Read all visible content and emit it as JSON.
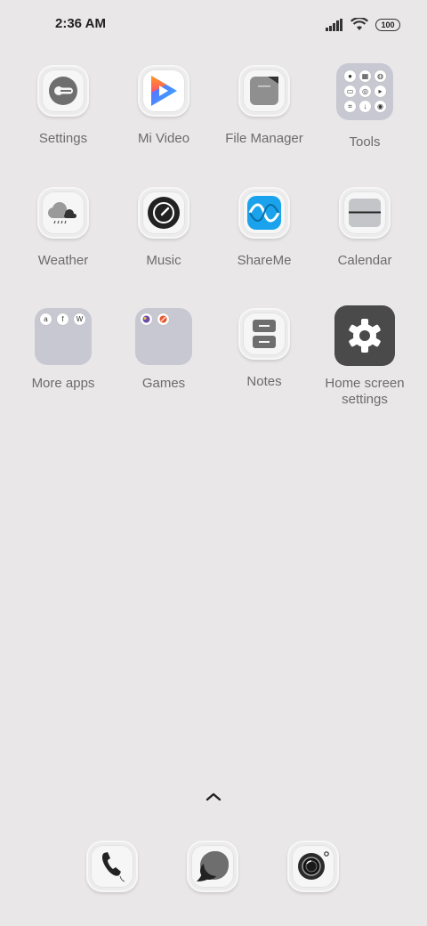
{
  "status_bar": {
    "time": "2:36 AM",
    "battery": "100"
  },
  "apps": {
    "settings": "Settings",
    "mi_video": "Mi Video",
    "file_manager": "File Manager",
    "tools": "Tools",
    "weather": "Weather",
    "music": "Music",
    "shareme": "ShareMe",
    "calendar": "Calendar",
    "more_apps": "More apps",
    "games": "Games",
    "notes": "Notes",
    "home_screen_settings_line1": "Home screen",
    "home_screen_settings_line2": "settings"
  },
  "folders": {
    "more_apps_icons": [
      "a",
      "f",
      "W"
    ]
  },
  "dock": {
    "items": [
      "phone-icon",
      "messages-icon",
      "camera-icon"
    ]
  },
  "colors": {
    "background": "#e9e7e8",
    "folder": "#c8c8d3",
    "shareme_blue": "#1aa3ec"
  }
}
